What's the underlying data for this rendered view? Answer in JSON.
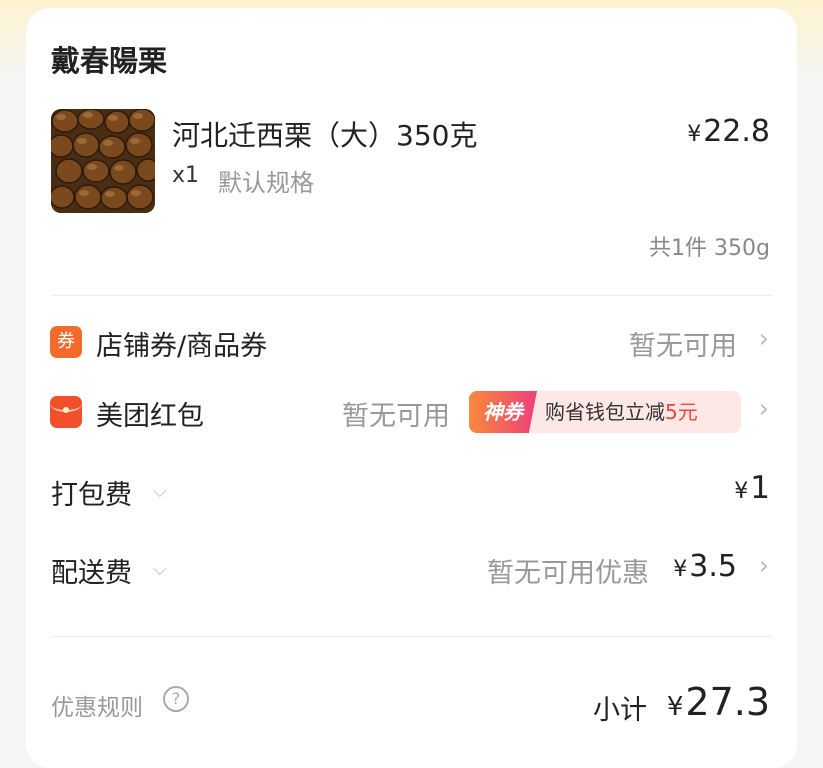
{
  "shop": {
    "name": "戴春陽栗"
  },
  "product": {
    "name": "河北迁西栗（大）350克",
    "price_symbol": "¥",
    "price": "22.8",
    "quantity": "x1",
    "spec": "默认规格",
    "image_icon": "chestnut-product-photo"
  },
  "summary": "共1件 350g",
  "coupon_row": {
    "icon_text": "券",
    "label": "店铺券/商品券",
    "value": "暂无可用"
  },
  "redpacket_row": {
    "label": "美团红包",
    "value": "暂无可用",
    "promo_tag": "神券",
    "promo_text": "购省钱包立减",
    "promo_amount": "5元"
  },
  "packing_row": {
    "label": "打包费",
    "symbol": "¥",
    "value": "1"
  },
  "delivery_row": {
    "label": "配送费",
    "note": "暂无可用优惠",
    "symbol": "¥",
    "value": "3.5"
  },
  "footer": {
    "rules_label": "优惠规则",
    "help_glyph": "?",
    "subtotal_label": "小计",
    "symbol": "¥",
    "subtotal": "27.3"
  },
  "colors": {
    "coupon_icon": "#f26b2b",
    "redpacket_icon": "#f2502b",
    "promo_gradient_start": "#f78a3c",
    "promo_gradient_end": "#ee3f7a",
    "promo_amount": "#f0433b"
  }
}
